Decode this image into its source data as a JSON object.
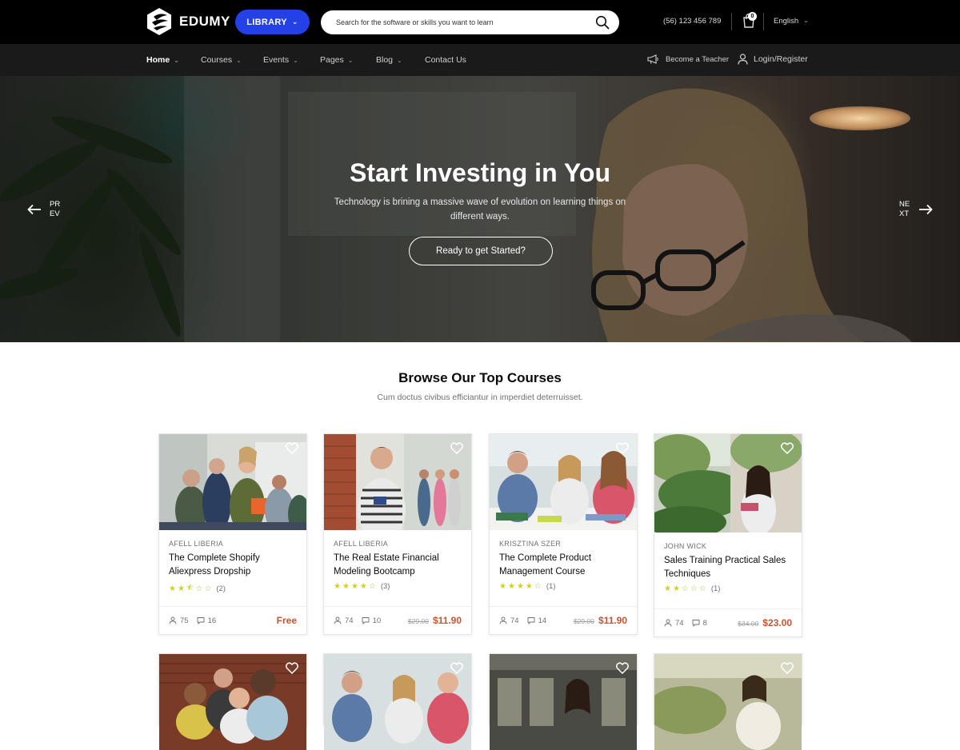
{
  "header": {
    "logo_text": "EDUMY",
    "library_label": "LIBRARY",
    "search_placeholder": "Search for the software or skills you want to learn",
    "phone": "(56) 123 456 789",
    "cart_count": "0",
    "language": "English"
  },
  "nav": {
    "items": [
      {
        "label": "Home"
      },
      {
        "label": "Courses"
      },
      {
        "label": "Events"
      },
      {
        "label": "Pages"
      },
      {
        "label": "Blog"
      },
      {
        "label": "Contact Us"
      }
    ],
    "become_teacher": "Become a Teacher",
    "login": "Login/Register"
  },
  "hero": {
    "title": "Start Investing in You",
    "subtitle": "Technology is brining a massive wave of evolution on learning things on different ways.",
    "cta": "Ready to get Started?",
    "prev_label": "PREV",
    "next_label": "NEXT"
  },
  "courses_section": {
    "title": "Browse Our Top Courses",
    "subtitle": "Cum doctus civibus efficiantur in imperdiet deterruisset."
  },
  "courses": [
    {
      "author": "AFELL LIBERIA",
      "title": "The Complete Shopify Aliexpress Dropship",
      "stars": 2.5,
      "reviews": "(2)",
      "students": "75",
      "comments": "16",
      "old_price": "",
      "price": "Free"
    },
    {
      "author": "AFELL LIBERIA",
      "title": "The Real Estate Financial Modeling Bootcamp",
      "stars": 4,
      "reviews": "(3)",
      "students": "74",
      "comments": "10",
      "old_price": "$29.00",
      "price": "$11.90"
    },
    {
      "author": "KRISZTINA SZER",
      "title": "The Complete Product Management Course",
      "stars": 4,
      "reviews": "(1)",
      "students": "74",
      "comments": "14",
      "old_price": "$29.00",
      "price": "$11.90"
    },
    {
      "author": "JOHN WICK",
      "title": "Sales Training Practical Sales Techniques",
      "stars": 2,
      "reviews": "(1)",
      "students": "74",
      "comments": "8",
      "old_price": "$34.00",
      "price": "$23.00"
    }
  ],
  "colors": {
    "accent": "#2441e7",
    "price": "#c75533",
    "star": "#ccd31a",
    "topbar": "#000000",
    "navbar": "#1a1a1a"
  },
  "icons": [
    "logo-icon",
    "chevron-down-icon",
    "search-icon",
    "cart-icon",
    "megaphone-icon",
    "user-icon",
    "arrow-left-icon",
    "arrow-right-icon",
    "heart-icon",
    "students-icon",
    "comments-icon",
    "star-icon"
  ]
}
